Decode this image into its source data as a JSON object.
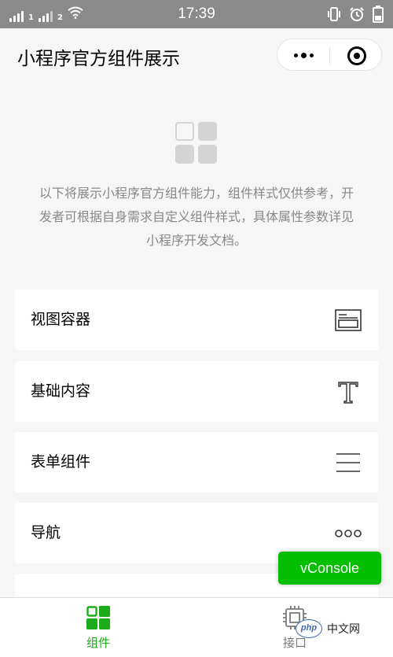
{
  "status_bar": {
    "time": "17:39",
    "sim_labels": [
      "1",
      "2"
    ],
    "icons": [
      "signal-icon",
      "wifi-icon",
      "vibrate-icon",
      "alarm-icon",
      "battery-icon"
    ]
  },
  "nav": {
    "title": "小程序官方组件展示",
    "more_icon": "more-dots-icon",
    "close_icon": "record-close-icon"
  },
  "intro": {
    "logo_icon": "component-grid-logo",
    "description": "以下将展示小程序官方组件能力，组件样式仅供参考，开发者可根据自身需求自定义组件样式，具体属性参数详见小程序开发文档。"
  },
  "menu": [
    {
      "label": "视图容器",
      "icon": "view-container-icon"
    },
    {
      "label": "基础内容",
      "icon": "text-t-icon"
    },
    {
      "label": "表单组件",
      "icon": "form-lines-icon"
    },
    {
      "label": "导航",
      "icon": "navigation-dots-icon"
    }
  ],
  "vconsole": {
    "label": "vConsole"
  },
  "tabbar": {
    "tabs": [
      {
        "label": "组件",
        "icon": "components-grid-icon",
        "active": true
      },
      {
        "label": "接口",
        "icon": "api-chip-icon",
        "active": false
      }
    ]
  },
  "watermark": {
    "badge": "php",
    "text": "中文网"
  },
  "colors": {
    "accent": "#1aad19",
    "vconsole_bg": "#04be02",
    "status_bar_bg": "#8a8a8a",
    "page_bg": "#f6f6f6"
  }
}
